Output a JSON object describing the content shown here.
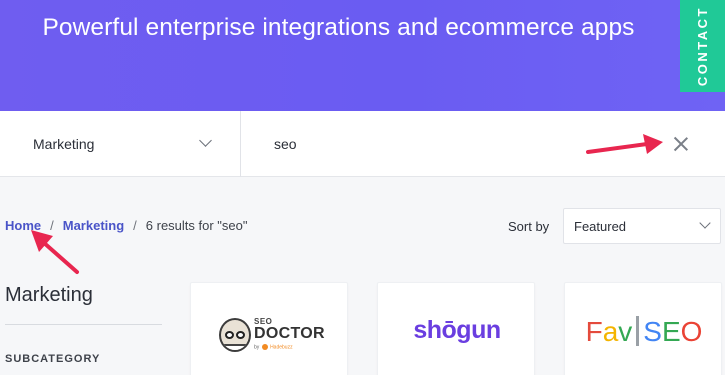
{
  "hero": {
    "title": "Powerful enterprise integrations and ecommerce apps",
    "contact_label": "CONTACT"
  },
  "filters": {
    "category": "Marketing",
    "search_value": "seo"
  },
  "breadcrumb": {
    "home": "Home",
    "sep1": "/",
    "category": "Marketing",
    "sep2": "/",
    "results": "6 results for \"seo\""
  },
  "sort": {
    "label": "Sort by",
    "value": "Featured"
  },
  "sidebar": {
    "heading": "Marketing",
    "subheading": "SUBCATEGORY"
  },
  "cards": [
    {
      "logo_text_small": "SEO",
      "logo_text": "DOCTOR",
      "logo_byline_prefix": "by",
      "logo_byline_brand": "Hadebuzz"
    },
    {
      "logo_text": "shōgun"
    },
    {
      "logo_text": "Fav SEO"
    }
  ],
  "colors": {
    "hero": "#6a5cf2",
    "contact_tab": "#20c997",
    "link": "#4a54c8",
    "annotation_arrow": "#e8264f"
  }
}
